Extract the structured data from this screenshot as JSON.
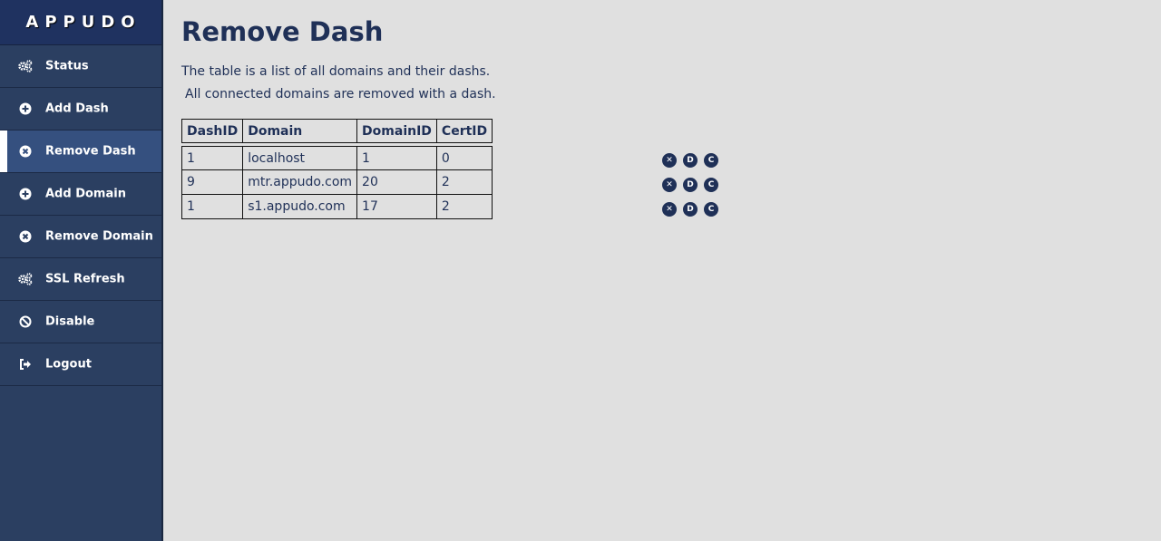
{
  "brand": "APPUDO",
  "sidebar": {
    "items": [
      {
        "label": "Status",
        "icon": "gears-icon"
      },
      {
        "label": "Add Dash",
        "icon": "plus-circle-icon"
      },
      {
        "label": "Remove Dash",
        "icon": "x-circle-icon",
        "active": true
      },
      {
        "label": "Add Domain",
        "icon": "plus-circle-icon"
      },
      {
        "label": "Remove Domain",
        "icon": "x-circle-icon"
      },
      {
        "label": "SSL Refresh",
        "icon": "gears-icon"
      },
      {
        "label": "Disable",
        "icon": "ban-icon"
      },
      {
        "label": "Logout",
        "icon": "sign-out-icon"
      }
    ]
  },
  "main": {
    "title": "Remove Dash",
    "description_1": "The table is a list of all domains and their dashs.",
    "description_2": "All connected domains are removed with a dash."
  },
  "table": {
    "headers": [
      "DashID",
      "Domain",
      "DomainID",
      "CertID"
    ],
    "rows": [
      [
        "1",
        "localhost",
        "1",
        "0"
      ],
      [
        "9",
        "mtr.appudo.com",
        "20",
        "2"
      ],
      [
        "1",
        "s1.appudo.com",
        "17",
        "2"
      ]
    ],
    "actions": [
      {
        "glyph": "✕",
        "icon": "remove-icon"
      },
      {
        "glyph": "D",
        "icon": "dash-icon"
      },
      {
        "glyph": "C",
        "icon": "cert-icon"
      }
    ]
  },
  "colors": {
    "sidebar_bg": "#2b3f61",
    "brand_bg": "#1f3260",
    "active_bg": "#35507f",
    "text": "#1f3057",
    "page_bg": "#e0e0e0"
  }
}
